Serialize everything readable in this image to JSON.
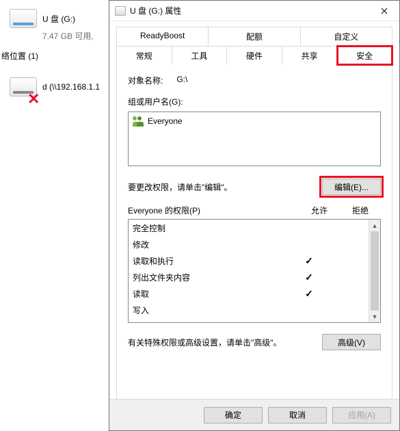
{
  "explorer": {
    "drive_name": "U 盘 (G:)",
    "drive_sub": "7.47 GB 可用,",
    "section": "络位置 (1)",
    "net_drive": "d (\\\\192.168.1.1"
  },
  "dialog": {
    "title": "U 盘 (G:) 属性",
    "tabs_row1": [
      "ReadyBoost",
      "配额",
      "自定义"
    ],
    "tabs_row2": [
      "常规",
      "工具",
      "硬件",
      "共享",
      "安全"
    ],
    "active_tab_index": 4,
    "object_label": "对象名称:",
    "object_value": "G:\\",
    "groups_label": "组或用户名(G):",
    "group_items": [
      "Everyone"
    ],
    "edit_hint": "要更改权限，请单击\"编辑\"。",
    "edit_button": "编辑(E)...",
    "perm_header_label": "Everyone 的权限(P)",
    "perm_allow": "允许",
    "perm_deny": "拒绝",
    "permissions": [
      {
        "name": "完全控制",
        "allow": false,
        "deny": false
      },
      {
        "name": "修改",
        "allow": false,
        "deny": false
      },
      {
        "name": "读取和执行",
        "allow": true,
        "deny": false
      },
      {
        "name": "列出文件夹内容",
        "allow": true,
        "deny": false
      },
      {
        "name": "读取",
        "allow": true,
        "deny": false
      },
      {
        "name": "写入",
        "allow": false,
        "deny": false
      }
    ],
    "advanced_hint": "有关特殊权限或高级设置，请单击\"高级\"。",
    "advanced_button": "高级(V)",
    "footer": {
      "ok": "确定",
      "cancel": "取消",
      "apply": "应用(A)"
    }
  }
}
